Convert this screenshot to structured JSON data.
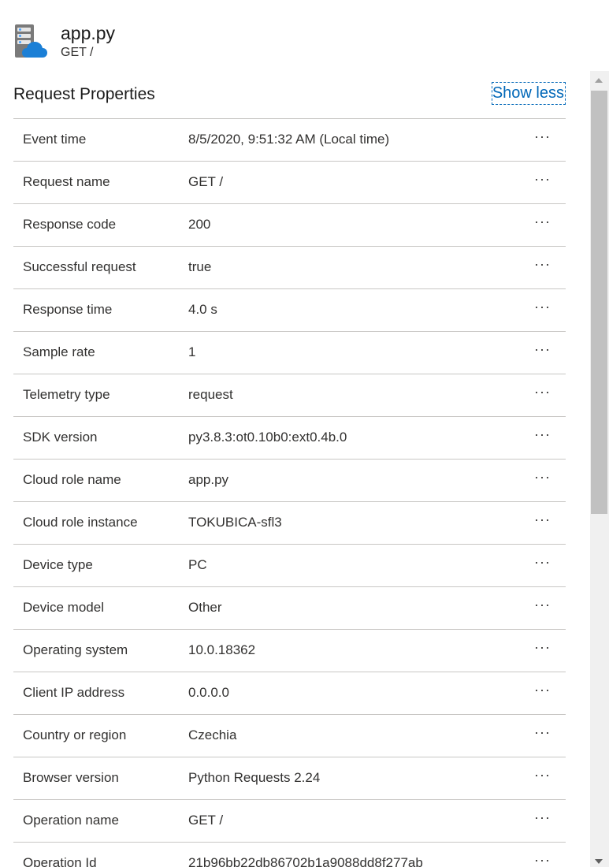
{
  "header": {
    "title": "app.py",
    "subtitle": "GET /",
    "icon": "app-service-cloud-icon"
  },
  "section": {
    "title": "Request Properties",
    "toggle_label": "Show less"
  },
  "properties": [
    {
      "name": "Event time",
      "value": "8/5/2020, 9:51:32 AM (Local time)"
    },
    {
      "name": "Request name",
      "value": "GET /"
    },
    {
      "name": "Response code",
      "value": "200"
    },
    {
      "name": "Successful request",
      "value": "true"
    },
    {
      "name": "Response time",
      "value": "4.0 s"
    },
    {
      "name": "Sample rate",
      "value": "1"
    },
    {
      "name": "Telemetry type",
      "value": "request"
    },
    {
      "name": "SDK version",
      "value": "py3.8.3:ot0.10b0:ext0.4b.0"
    },
    {
      "name": "Cloud role name",
      "value": "app.py"
    },
    {
      "name": "Cloud role instance",
      "value": "TOKUBICA-sfl3"
    },
    {
      "name": "Device type",
      "value": "PC"
    },
    {
      "name": "Device model",
      "value": "Other"
    },
    {
      "name": "Operating system",
      "value": "10.0.18362"
    },
    {
      "name": "Client IP address",
      "value": "0.0.0.0"
    },
    {
      "name": "Country or region",
      "value": "Czechia"
    },
    {
      "name": "Browser version",
      "value": "Python Requests 2.24"
    },
    {
      "name": "Operation name",
      "value": "GET /"
    },
    {
      "name": "Operation Id",
      "value": "21b96bb22db86702b1a9088dd8f277ab"
    }
  ],
  "row_more_label": "···",
  "colors": {
    "link": "#0067b8",
    "divider": "#c8c6c4",
    "text": "#323130"
  }
}
